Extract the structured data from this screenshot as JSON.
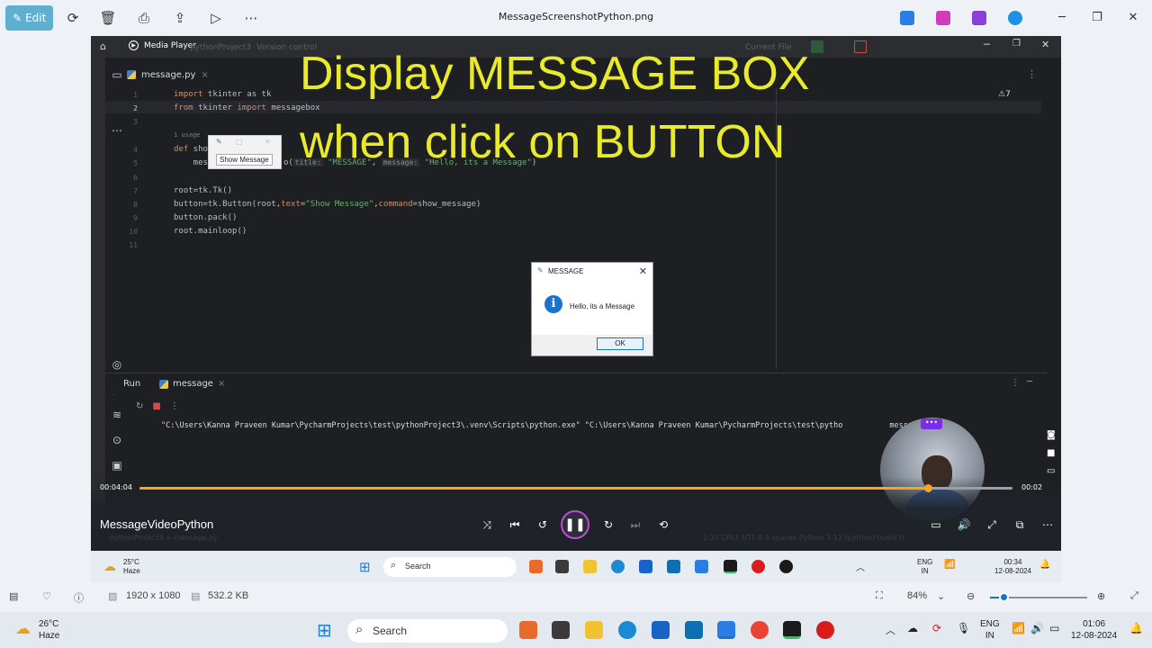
{
  "toolbar": {
    "edit_label": "Edit",
    "file_title": "MessageScreenshotPython.png"
  },
  "ide": {
    "media_player_label": "Media Player",
    "faint_project": "pythonProject3",
    "faint_vc": "Version control",
    "faint_current_file": "Current File",
    "tab_label": "message.py",
    "warnings": "⚠7",
    "usage_hint": "1 usage",
    "line_numbers": [
      "1",
      "2",
      "3",
      "4",
      "5",
      "6",
      "7",
      "8",
      "9",
      "10",
      "11"
    ],
    "code": {
      "l1_kw": "import",
      "l1_rest": " tkinter as tk",
      "l2_kw1": "from",
      "l2_mid": " tkinter ",
      "l2_kw2": "import",
      "l2_rest": " messagebox",
      "l4_kw": "def",
      "l4_rest": " sho",
      "l5_a": "    mes",
      "l5_b": "o(",
      "l5_hint1": "title:",
      "l5_str1": " \"MESSAGE\"",
      "l5_comma": ",",
      "l5_hint2": "message:",
      "l5_str2": " \"Hello, its a Message\"",
      "l5_end": ")",
      "l7": "root=tk.Tk()",
      "l8_a": "button=tk.Button(root,",
      "l8_kw1": "text",
      "l8_b": "=",
      "l8_str": "\"Show Message\"",
      "l8_c": ",",
      "l8_kw2": "command",
      "l8_d": "=show_message)",
      "l9": "button.pack()",
      "l10": "root.mainloop()"
    },
    "mini_window_button": "Show Message",
    "overlay_line1": "Display MESSAGE BOX",
    "overlay_line2": "when click on BUTTON"
  },
  "dialog": {
    "title": "MESSAGE",
    "message": "Hello, its a Message",
    "ok_label": "OK"
  },
  "run": {
    "run_label": "Run",
    "config_label": "message",
    "command": "\"C:\\Users\\Kanna Praveen Kumar\\PycharmProjects\\test\\pythonProject3\\.venv\\Scripts\\python.exe\" \"C:\\Users\\Kanna Praveen Kumar\\PycharmProjects\\test\\pytho"
  },
  "command_tail": "message.py\"",
  "player": {
    "time_elapsed": "00:04:04",
    "time_total": "00:02",
    "progress": 0.903,
    "video_name": "MessageVideoPython",
    "faint_status": "pythonProject3  >  message.py",
    "faint_status_right": "2:31    CRLF    UTF-8    4 spaces    Python 3.12 (pythonProject3)"
  },
  "inner_taskbar": {
    "temp": "25°C",
    "condition": "Haze",
    "search_label": "Search",
    "lang": "ENG",
    "region": "IN",
    "time": "00:34",
    "date": "12-08-2024"
  },
  "bottombar": {
    "resolution": "1920 x 1080",
    "file_size": "532.2 KB",
    "zoom": "84%",
    "zoom_level": 0.15
  },
  "taskbar": {
    "temp": "26°C",
    "condition": "Haze",
    "search_label": "Search",
    "lang": "ENG",
    "region": "IN",
    "time": "01:06",
    "date": "12-08-2024"
  },
  "colors": {
    "accent": "#f5a623",
    "overlay_text": "#e8ea2a",
    "ide_bg": "#1e1f22"
  }
}
